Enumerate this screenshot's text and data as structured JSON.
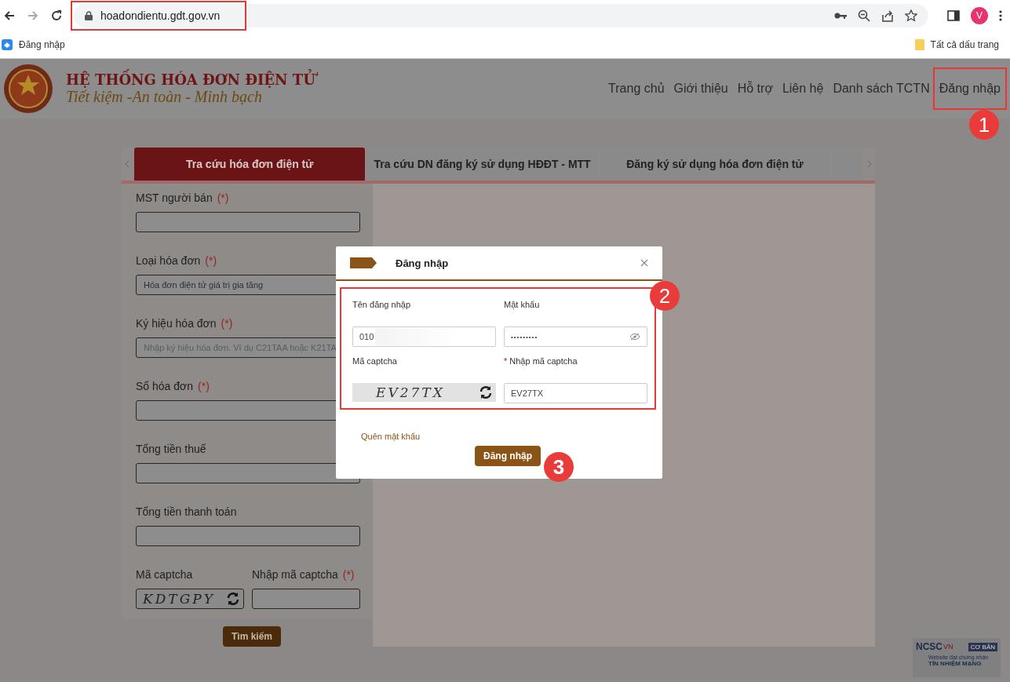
{
  "browser": {
    "url": "hoadondientu.gdt.gov.vn",
    "url_highlighted": true,
    "profile_initial": "V",
    "bookmarks": [
      {
        "label": "Đăng nhập"
      }
    ],
    "all_bookmarks": "Tất cả dấu trang"
  },
  "site": {
    "title": "HỆ THỐNG HÓA ĐƠN ĐIỆN TỬ",
    "slogan": "Tiết kiệm -An toàn - Minh bạch",
    "nav": [
      {
        "label": "Trang chủ"
      },
      {
        "label": "Giới thiệu"
      },
      {
        "label": "Hỗ trợ"
      },
      {
        "label": "Liên hệ"
      },
      {
        "label": "Danh sách TCTN"
      },
      {
        "label": "Đăng nhập",
        "callout": "1"
      }
    ]
  },
  "tabs": [
    {
      "label": "Tra cứu hóa đơn điện tử",
      "selected": true
    },
    {
      "label": "Tra cứu DN đăng ký sử dụng HĐĐT - MTT",
      "selected": false
    },
    {
      "label": "Đăng ký sử dụng hóa đơn điện tử",
      "selected": false
    }
  ],
  "search_form": {
    "fields": [
      {
        "label": "MST người bán",
        "required_mark": "(*)",
        "kind": "text"
      },
      {
        "label": "Loại hóa đơn",
        "required_mark": "(*)",
        "kind": "select",
        "value": "Hóa đơn điện tử giá trị gia tăng"
      },
      {
        "label": "Ký hiệu hóa đơn",
        "required_mark": "(*)",
        "kind": "text",
        "placeholder": "Nhập ký hiệu hóa đơn. Ví dụ C21TAA hoặc K21TA"
      },
      {
        "label": "Số hóa đơn",
        "required_mark": "(*)",
        "kind": "text"
      },
      {
        "label": "Tổng tiền thuế",
        "kind": "text"
      },
      {
        "label": "Tổng tiền thanh toán",
        "kind": "text"
      }
    ],
    "captcha_label": "Mã captcha",
    "captcha_image_text": "KDTGPY",
    "captcha_input_label": "Nhập mã captcha",
    "captcha_required_mark": "(*)",
    "submit": "Tìm kiếm"
  },
  "login_dialog": {
    "title": "Đăng nhập",
    "callout": "2",
    "username": {
      "label": "Tên đăng nhập",
      "value": "010"
    },
    "password": {
      "label": "Mật khẩu",
      "value": "•••••••••"
    },
    "captcha": {
      "label": "Mã captcha",
      "image_text": "EV27TX"
    },
    "captcha_input": {
      "label": "Nhập mã captcha",
      "required_mark": "*",
      "value": "EV27TX"
    },
    "forgot_link": "Quên mật khẩu",
    "submit": "Đăng nhập",
    "submit_callout": "3"
  },
  "trust_badge": {
    "org": "NCSC",
    "org_suffix": "VN",
    "level": "CƠ BẢN",
    "line1": "Website đạt chứng nhận",
    "line2": "TÍN NHIỆM MẠNG"
  }
}
